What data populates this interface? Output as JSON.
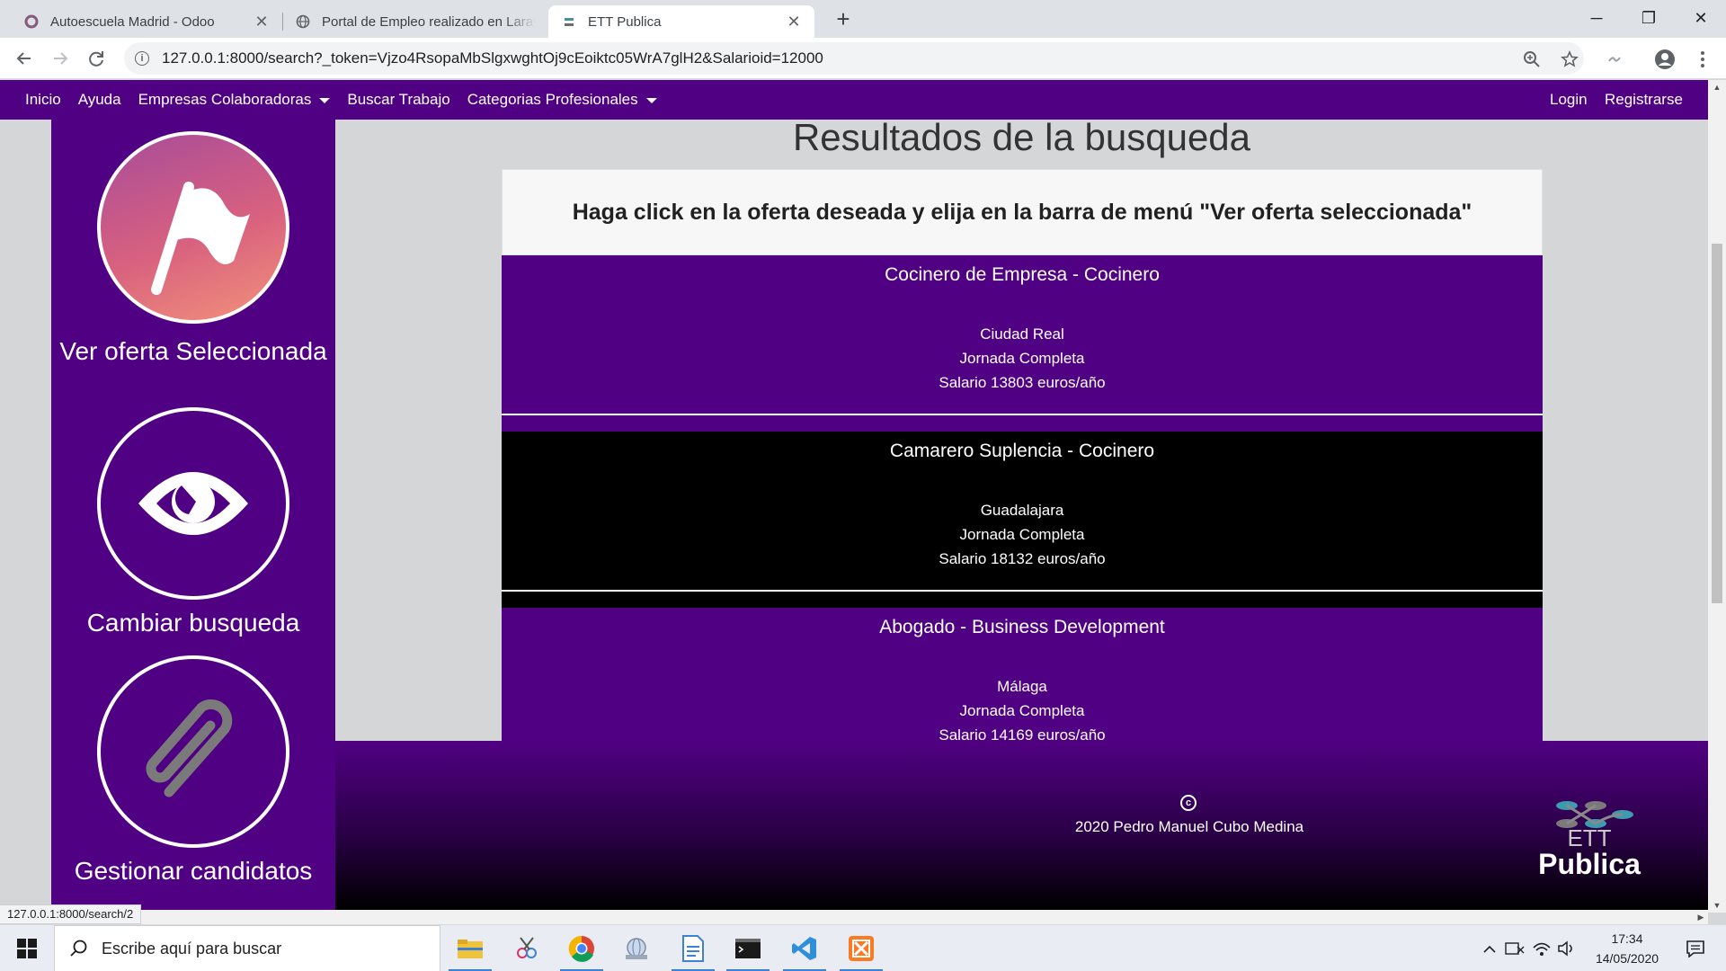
{
  "browser": {
    "tabs": [
      {
        "title": "Autoescuela Madrid - Odoo",
        "icon": "odoo-icon",
        "close": "✕"
      },
      {
        "title": "Portal de Empleo realizado en Laravel",
        "icon": "globe-icon"
      },
      {
        "title": "ETT Publica",
        "icon": "ett-favicon",
        "close": "✕"
      }
    ],
    "new_tab": "+",
    "window_controls": {
      "minimize": "─",
      "maximize": "❐",
      "close": "✕"
    },
    "url": "127.0.0.1:8000/search?_token=Vjzo4RsopaMbSlgxwghtOj9cEoiktc05WrA7glH2&Salarioid=12000",
    "status_url": "127.0.0.1:8000/search/2"
  },
  "site_nav": {
    "left": [
      {
        "label": "Inicio"
      },
      {
        "label": "Ayuda"
      },
      {
        "label": "Empresas Colaboradoras",
        "dropdown": true
      },
      {
        "label": "Buscar Trabajo"
      },
      {
        "label": "Categorias Profesionales",
        "dropdown": true
      }
    ],
    "right": [
      {
        "label": "Login"
      },
      {
        "label": "Registrarse"
      }
    ]
  },
  "sidebar": {
    "items": [
      {
        "label": "Ver oferta Seleccionada",
        "icon": "flag-icon"
      },
      {
        "label": "Cambiar busqueda",
        "icon": "eye-icon"
      },
      {
        "label": "Gestionar candidatos",
        "icon": "paperclip-icon"
      }
    ]
  },
  "main": {
    "title": "Resultados de la busqueda",
    "instruction": "Haga click en la oferta deseada y elija en la barra de menú \"Ver oferta seleccionada\"",
    "offers": [
      {
        "title": "Cocinero de Empresa - Cocinero",
        "city": "Ciudad Real",
        "schedule": "Jornada Completa",
        "salary": "Salario 13803 euros/año",
        "color": "#500082"
      },
      {
        "title": "Camarero Suplencia - Cocinero",
        "city": "Guadalajara",
        "schedule": "Jornada Completa",
        "salary": "Salario 18132 euros/año",
        "color": "#000000"
      },
      {
        "title": "Abogado - Business Development",
        "city": "Málaga",
        "schedule": "Jornada Completa",
        "salary": "Salario 14169 euros/año",
        "color": "#500082"
      }
    ]
  },
  "footer": {
    "copyright_symbol": "c",
    "copyright": "2020 Pedro Manuel Cubo Medina",
    "logo_line1": "ETT",
    "logo_line2": "Publica"
  },
  "taskbar": {
    "search_placeholder": "Escribe aquí para buscar",
    "time": "17:34",
    "date": "14/05/2020"
  },
  "colors": {
    "brand_purple": "#500082",
    "offer_dark": "#000000",
    "page_bg": "#d4d6d7"
  }
}
